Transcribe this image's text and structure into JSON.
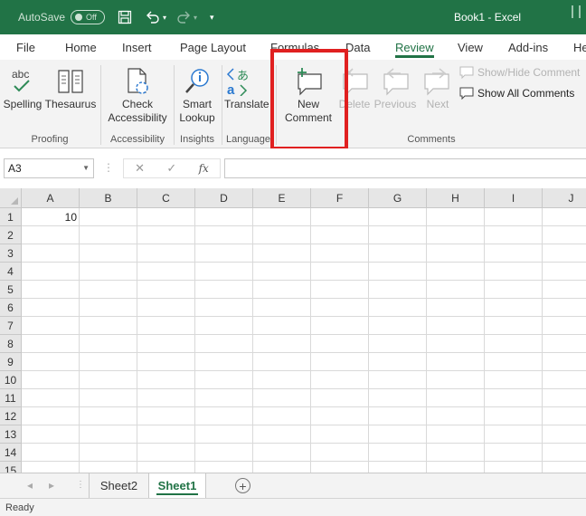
{
  "titlebar": {
    "autosave_label": "AutoSave",
    "autosave_state": "Off",
    "doc_title": "Book1  -  Excel",
    "accent": "#217346"
  },
  "tabs": [
    {
      "label": "File",
      "active": false
    },
    {
      "label": "Home",
      "active": false
    },
    {
      "label": "Insert",
      "active": false
    },
    {
      "label": "Page Layout",
      "active": false
    },
    {
      "label": "Formulas",
      "active": false
    },
    {
      "label": "Data",
      "active": false
    },
    {
      "label": "Review",
      "active": true
    },
    {
      "label": "View",
      "active": false
    },
    {
      "label": "Add-ins",
      "active": false
    },
    {
      "label": "He",
      "active": false
    }
  ],
  "ribbon": {
    "proofing": {
      "label": "Proofing",
      "spelling": "Spelling",
      "thesaurus": "Thesaurus"
    },
    "accessibility": {
      "label": "Accessibility",
      "check_line1": "Check",
      "check_line2": "Accessibility"
    },
    "insights": {
      "label": "Insights",
      "smart_line1": "Smart",
      "smart_line2": "Lookup"
    },
    "language": {
      "label": "Language",
      "translate": "Translate"
    },
    "comments": {
      "label": "Comments",
      "new_line1": "New",
      "new_line2": "Comment",
      "delete": "Delete",
      "previous": "Previous",
      "next": "Next",
      "show_hide": "Show/Hide Comment",
      "show_all": "Show All Comments"
    },
    "highlight_color": "#e02020"
  },
  "formula_bar": {
    "name_box": "A3",
    "fx": "fx",
    "value": ""
  },
  "grid": {
    "columns": [
      "A",
      "B",
      "C",
      "D",
      "E",
      "F",
      "G",
      "H",
      "I",
      "J"
    ],
    "rows": [
      "1",
      "2",
      "3",
      "4",
      "5",
      "6",
      "7",
      "8",
      "9",
      "10",
      "11",
      "12",
      "13",
      "14",
      "15"
    ],
    "cells": [
      {
        "ref": "A1",
        "value": "10"
      }
    ]
  },
  "sheets": [
    {
      "name": "Sheet2",
      "active": false
    },
    {
      "name": "Sheet1",
      "active": true
    }
  ],
  "status": {
    "text": "Ready"
  }
}
